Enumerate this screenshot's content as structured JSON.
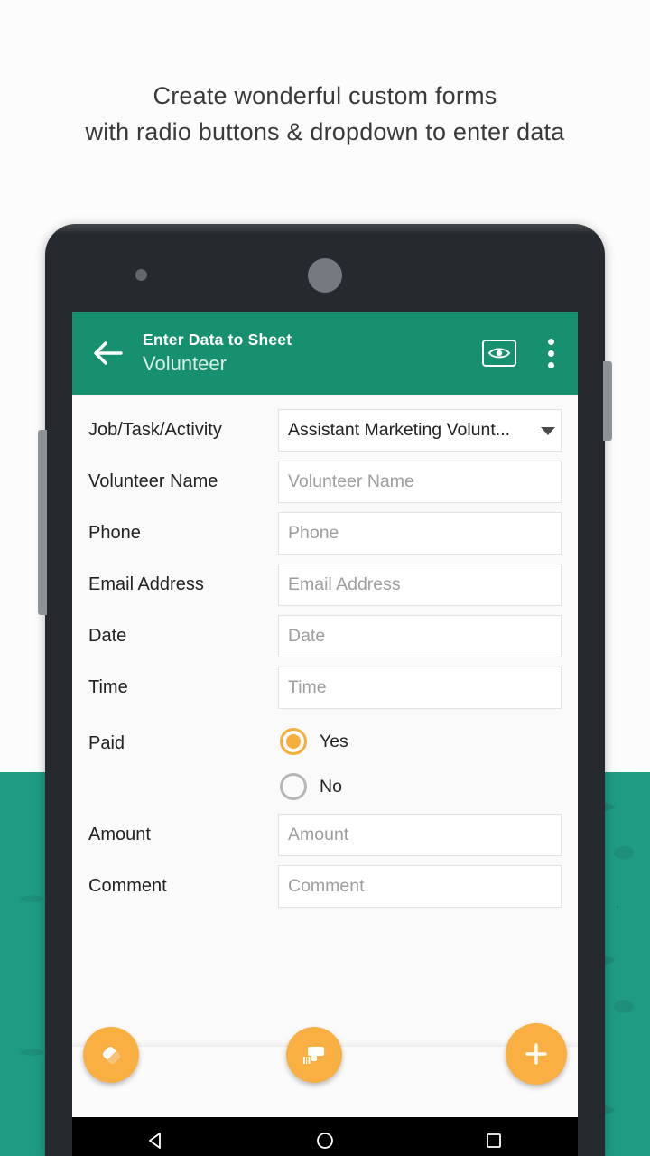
{
  "headline": "Create wonderful custom forms\nwith radio buttons & dropdown to enter data",
  "colors": {
    "appbar_green": "#17906f",
    "background_teal": "#1f9b84",
    "fab_orange": "#f9af41",
    "radio_selected": "#f6ae3c",
    "placeholder_gray": "#9e9e9e"
  },
  "appbar": {
    "back_label": "Back",
    "title": "Enter Data to Sheet",
    "subtitle": "Volunteer",
    "preview_icon": "eye-icon",
    "overflow_icon": "more-vertical-icon"
  },
  "form": {
    "rows": [
      {
        "label": "Job/Task/Activity",
        "type": "dropdown",
        "value": "Assistant Marketing Volunt...",
        "placeholder": "Job/Task/Activity"
      },
      {
        "label": "Volunteer Name",
        "type": "text",
        "value": "",
        "placeholder": "Volunteer Name"
      },
      {
        "label": "Phone",
        "type": "text",
        "value": "",
        "placeholder": "Phone"
      },
      {
        "label": "Email Address",
        "type": "text",
        "value": "",
        "placeholder": "Email Address"
      },
      {
        "label": "Date",
        "type": "text",
        "value": "",
        "placeholder": "Date"
      },
      {
        "label": "Time",
        "type": "text",
        "value": "",
        "placeholder": "Time"
      },
      {
        "label": "Paid",
        "type": "radio",
        "options": [
          {
            "label": "Yes",
            "selected": true
          },
          {
            "label": "No",
            "selected": false
          }
        ]
      },
      {
        "label": "Amount",
        "type": "text",
        "value": "",
        "placeholder": "Amount"
      },
      {
        "label": "Comment",
        "type": "text",
        "value": "",
        "placeholder": "Comment"
      }
    ]
  },
  "fabs": [
    {
      "name": "clear-form-fab",
      "icon": "eraser-icon"
    },
    {
      "name": "barcode-scan-fab",
      "icon": "barcode-scanner-icon"
    },
    {
      "name": "add-record-fab",
      "icon": "plus-icon"
    }
  ],
  "navbar": {
    "back": "back-triangle-icon",
    "home": "home-circle-icon",
    "recents": "recents-square-icon"
  }
}
